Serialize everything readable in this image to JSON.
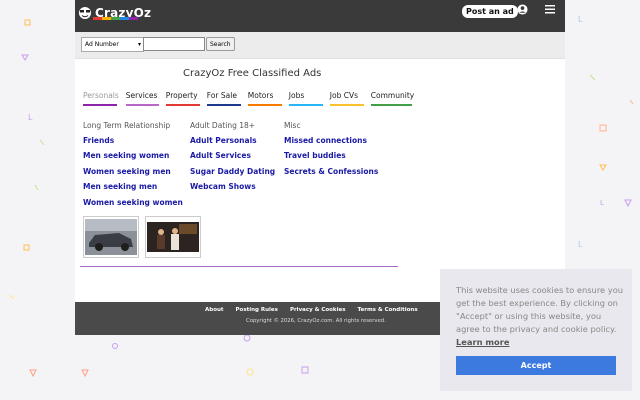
{
  "header": {
    "logo_text": "CrazyOz",
    "post_ad_label": "Post an ad",
    "icons": [
      "user-icon",
      "menu-icon"
    ]
  },
  "search": {
    "category_selected": "Ad Number",
    "input_value": "",
    "button_label": "Search"
  },
  "main": {
    "title": "CrazyOz Free Classified Ads",
    "tabs": [
      {
        "label": "Personals",
        "color": "#8e24aa",
        "active": true
      },
      {
        "label": "Services",
        "color": "#ba68c8",
        "active": false
      },
      {
        "label": "Property",
        "color": "#e53935",
        "active": false
      },
      {
        "label": "For Sale",
        "color": "#1e3a8a",
        "active": false
      },
      {
        "label": "Motors",
        "color": "#f57c00",
        "active": false
      },
      {
        "label": "Jobs",
        "color": "#29b6f6",
        "active": false
      },
      {
        "label": "Job CVs",
        "color": "#fbc02d",
        "active": false
      },
      {
        "label": "Community",
        "color": "#43a047",
        "active": false
      }
    ],
    "columns": [
      {
        "heading": "Long Term Relationship",
        "links": [
          "Friends",
          "Men seeking women",
          "Women seeking men",
          "Men seeking men",
          "Women seeking women"
        ]
      },
      {
        "heading": "Adult Dating 18+",
        "links": [
          "Adult Personals",
          "Adult Services",
          "Sugar Daddy Dating",
          "Webcam Shows"
        ]
      },
      {
        "heading": "Misc",
        "links": [
          "Missed connections",
          "Travel buddies",
          "Secrets & Confessions"
        ]
      }
    ]
  },
  "footer": {
    "links": [
      "About",
      "Posting Rules",
      "Privacy & Cookies",
      "Terms & Conditions"
    ],
    "copyright": "Copyright © 2026, CrazyOz.com. All rights reserved."
  },
  "cookie_banner": {
    "text": "This website uses cookies to ensure you get the best experience. By clicking on \"Accept\" or using this website, you agree to the privacy and cookie policy.",
    "learn_more": "Learn more",
    "accept_label": "Accept",
    "accent_color": "#3c7ae0"
  }
}
